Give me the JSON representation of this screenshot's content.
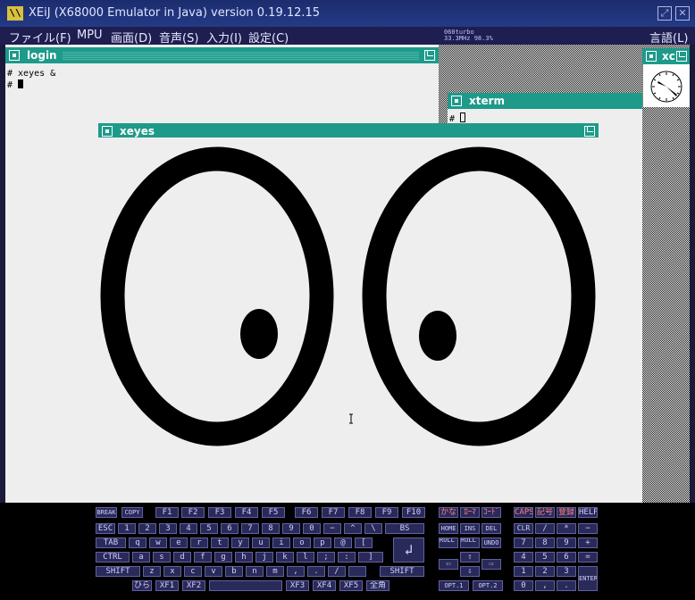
{
  "window": {
    "title": "XEiJ (X68000 Emulator in Java) version 0.19.12.15",
    "app_icon": "xeij-logo-icon",
    "buttons": [
      "maximize",
      "close"
    ]
  },
  "menubar": {
    "items": [
      "ファイル(F)",
      "MPU",
      "画面(D)",
      "音声(S)",
      "入力(I)",
      "設定(C)"
    ],
    "language": "言語(L)",
    "status": {
      "line1": "060turbo",
      "line2": "33.3MHz  98.3%"
    }
  },
  "login_window": {
    "title": "login",
    "lines": [
      "# xeyes &",
      "# "
    ]
  },
  "xterm_window": {
    "title": "xterm",
    "prompt": "# "
  },
  "xclock_window": {
    "title": "xc"
  },
  "xeyes_window": {
    "title": "xeyes"
  },
  "colors": {
    "title_bar_accent": "#1e9a8a",
    "desktop": "#eeeeee",
    "host_titlebar": "#1c2c6e",
    "key_face": "#2a2a5a",
    "key_red_text": "#ff8080"
  },
  "keyboard": {
    "top_keys": [
      "BREAK",
      "COPY",
      "F1",
      "F2",
      "F3",
      "F4",
      "F5",
      "F6",
      "F7",
      "F8",
      "F9",
      "F10",
      "かな",
      "ﾛｰﾏ",
      "ｺｰﾄﾞ",
      "CAPS",
      "記号",
      "登録",
      "HELP"
    ],
    "row1": [
      "ESC",
      "1",
      "2",
      "3",
      "4",
      "5",
      "6",
      "7",
      "8",
      "9",
      "0",
      "−",
      "^",
      "\\",
      "BS"
    ],
    "row2": [
      "TAB",
      "q",
      "w",
      "e",
      "r",
      "t",
      "y",
      "u",
      "i",
      "o",
      "p",
      "@",
      "["
    ],
    "row3": [
      "CTRL",
      "a",
      "s",
      "d",
      "f",
      "g",
      "h",
      "j",
      "k",
      "l",
      ";",
      ":",
      "]"
    ],
    "row4": [
      "SHIFT",
      "z",
      "x",
      "c",
      "v",
      "b",
      "n",
      "m",
      ",",
      ".",
      "/",
      "",
      "SHIFT"
    ],
    "row5": [
      "ひら",
      "XF1",
      "XF2",
      "",
      "XF3",
      "XF4",
      "XF5",
      "全角"
    ],
    "return_glyph": "↲",
    "edit_keys": [
      "HOME",
      "INS",
      "DEL",
      "ROLL UP",
      "ROLL DOWN",
      "UNDO"
    ],
    "arrows": [
      "⇧",
      "⇦",
      "⇨",
      "⇩"
    ],
    "opt_keys": [
      "OPT.1",
      "OPT.2"
    ],
    "numpad": [
      "CLR",
      "/",
      "*",
      "−",
      "7",
      "8",
      "9",
      "+",
      "4",
      "5",
      "6",
      "=",
      "1",
      "2",
      "3",
      "0",
      ",",
      ".",
      "ENTER"
    ]
  }
}
